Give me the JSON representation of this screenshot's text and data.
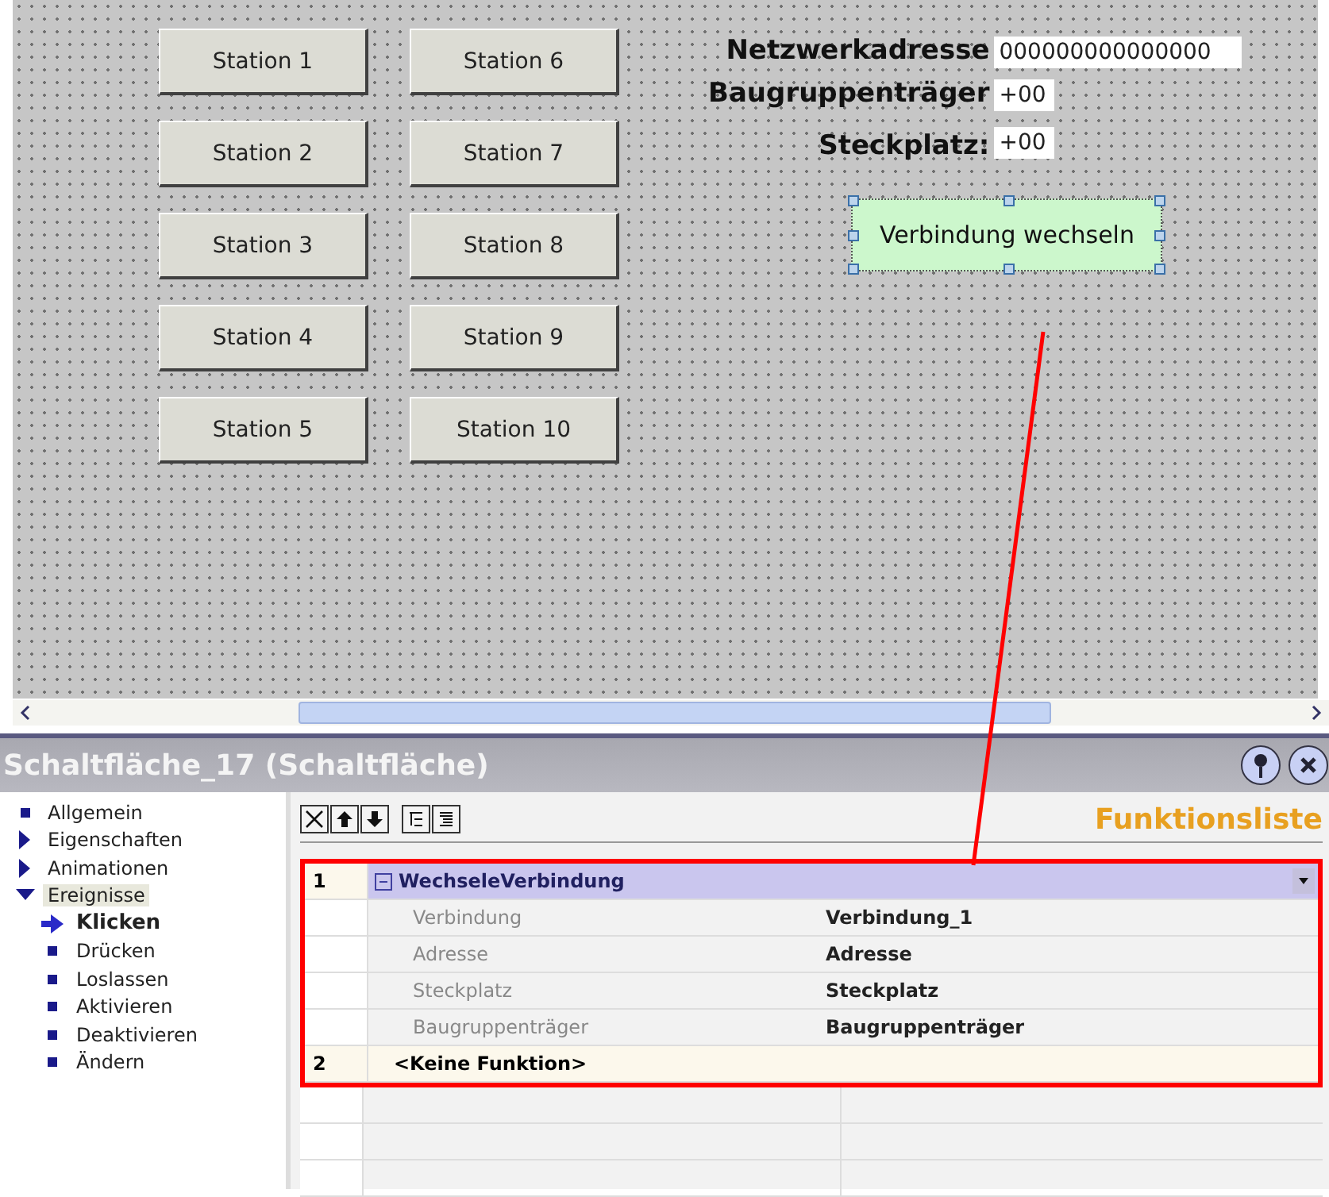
{
  "canvas": {
    "station_buttons": [
      "Station 1",
      "Station 2",
      "Station 3",
      "Station 4",
      "Station 5",
      "Station 6",
      "Station 7",
      "Station 8",
      "Station 9",
      "Station 10"
    ],
    "fields": [
      {
        "label": "Netzwerkadresse",
        "value": "000000000000000"
      },
      {
        "label": "Baugruppenträger",
        "value": "+00"
      },
      {
        "label": "Steckplatz:",
        "value": "+00"
      }
    ],
    "selected_button": {
      "label": "Verbindung wechseln"
    }
  },
  "properties_panel": {
    "title": "Schaltfläche_17 (Schaltfläche)",
    "tree": [
      {
        "label": "Allgemein",
        "kind": "item",
        "selected": false
      },
      {
        "label": "Eigenschaften",
        "kind": "group",
        "expanded": false,
        "selected": false
      },
      {
        "label": "Animationen",
        "kind": "group",
        "expanded": false,
        "selected": false
      },
      {
        "label": "Ereignisse",
        "kind": "group",
        "expanded": true,
        "selected": true,
        "children": [
          {
            "label": "Klicken",
            "selected": true
          },
          {
            "label": "Drücken",
            "selected": false
          },
          {
            "label": "Loslassen",
            "selected": false
          },
          {
            "label": "Aktivieren",
            "selected": false
          },
          {
            "label": "Deaktivieren",
            "selected": false
          },
          {
            "label": "Ändern",
            "selected": false
          }
        ]
      }
    ],
    "heading": "Funktionsliste",
    "functions": [
      {
        "number": "1",
        "name": "WechseleVerbindung",
        "expanded": true,
        "params": [
          {
            "name": "Verbindung",
            "value": "Verbindung_1"
          },
          {
            "name": "Adresse",
            "value": "Adresse"
          },
          {
            "name": "Steckplatz",
            "value": "Steckplatz"
          },
          {
            "name": "Baugruppenträger",
            "value": "Baugruppenträger"
          }
        ]
      },
      {
        "number": "2",
        "name": "<Keine Funktion>"
      }
    ]
  }
}
